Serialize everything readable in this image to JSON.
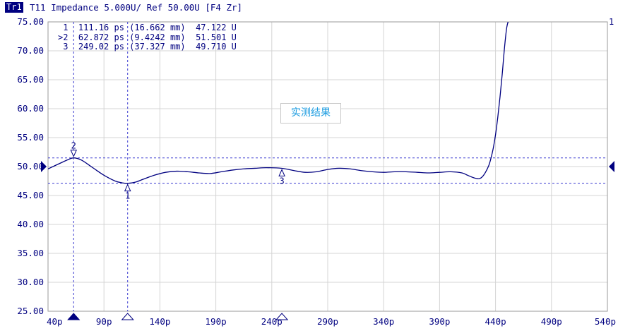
{
  "header": {
    "trace_badge": "Tr1",
    "trace_info": "T11 Impedance 5.000U/ Ref 50.00U [F4 Zr]"
  },
  "marker_table": [
    {
      "id": "1",
      "time": "111.16 ps",
      "distance": "(16.662 mm)",
      "value": "47.122 U",
      "active": false
    },
    {
      "id": ">2",
      "time": "62.872 ps",
      "distance": "(9.4242 mm)",
      "value": "51.501 U",
      "active": true
    },
    {
      "id": "3",
      "time": "249.02 ps",
      "distance": "(37.327 mm)",
      "value": "49.710 U",
      "active": false
    }
  ],
  "annotation": "实测结果",
  "scale_end_label": "1",
  "colors": {
    "trace": "#000080",
    "grid": "#d4d4d4",
    "axis_text": "#000080",
    "annotation_text": "#1a9be0"
  },
  "chart_data": {
    "type": "line",
    "xlabel": "",
    "ylabel": "",
    "x_range": [
      40,
      540
    ],
    "y_range": [
      25,
      75
    ],
    "x_ticks": [
      "40p",
      "90p",
      "140p",
      "190p",
      "240p",
      "290p",
      "340p",
      "390p",
      "440p",
      "490p",
      "540p"
    ],
    "y_ticks": [
      "75.00",
      "70.00",
      "65.00",
      "60.00",
      "55.00",
      "50.00",
      "45.00",
      "40.00",
      "35.00",
      "30.00",
      "25.00"
    ],
    "grid": true,
    "ref_level": 50,
    "series": [
      {
        "x": [
          40,
          50,
          58,
          63,
          70,
          80,
          90,
          100,
          106,
          111,
          118,
          125,
          135,
          145,
          155,
          165,
          175,
          185,
          195,
          205,
          215,
          225,
          235,
          249,
          260,
          270,
          280,
          290,
          300,
          310,
          320,
          330,
          340,
          350,
          360,
          370,
          380,
          390,
          400,
          410,
          415,
          420,
          425,
          428,
          431,
          434,
          436,
          438,
          440,
          442,
          444,
          446,
          448,
          450,
          452,
          454
        ],
        "y": [
          49.6,
          50.5,
          51.2,
          51.5,
          51.1,
          49.8,
          48.5,
          47.5,
          47.2,
          47.1,
          47.3,
          47.8,
          48.5,
          49.0,
          49.2,
          49.1,
          48.9,
          48.8,
          49.1,
          49.4,
          49.6,
          49.7,
          49.8,
          49.7,
          49.3,
          49.0,
          49.1,
          49.5,
          49.7,
          49.6,
          49.3,
          49.1,
          49.0,
          49.1,
          49.1,
          49.0,
          48.9,
          49.0,
          49.1,
          48.9,
          48.5,
          48.1,
          47.9,
          48.2,
          49.0,
          50.2,
          51.5,
          53.2,
          55.5,
          58.5,
          62.0,
          66.0,
          70.5,
          74.0,
          75.5,
          77.0
        ]
      }
    ],
    "markers": [
      {
        "label": "1",
        "x": 111.16,
        "y": 47.122
      },
      {
        "label": "2",
        "x": 62.872,
        "y": 51.501
      },
      {
        "label": "3",
        "x": 249.02,
        "y": 49.71
      }
    ]
  }
}
